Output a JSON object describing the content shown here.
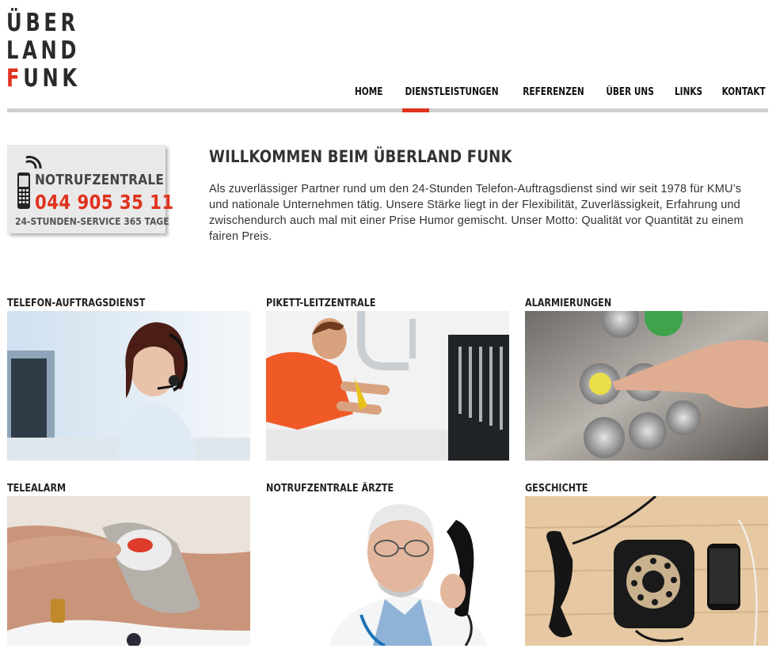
{
  "logo": {
    "line1": "ÜBER",
    "line2": "LAND",
    "line3_first": "F",
    "line3_rest": "UNK"
  },
  "nav": {
    "items": [
      {
        "label": "HOME",
        "active": true
      },
      {
        "label": "DIENSTLEISTUNGEN",
        "active": false
      },
      {
        "label": "REFERENZEN",
        "active": false
      },
      {
        "label": "ÜBER UNS",
        "active": false
      },
      {
        "label": "LINKS",
        "active": false
      },
      {
        "label": "KONTAKT",
        "active": false
      }
    ]
  },
  "badge": {
    "title": "NOTRUFZENTRALE",
    "number": "044 905 35 11",
    "subtitle": "24-STUNDEN-SERVICE 365 TAGE",
    "icon": "mobile-phone-icon"
  },
  "welcome": {
    "title": "WILLKOMMEN BEIM ÜBERLAND FUNK",
    "text": "Als zuverlässiger Partner rund um den 24-Stunden Telefon-Auftragsdienst sind wir seit 1978 für KMU’s und nationale Unternehmen tätig. Unsere Stärke liegt in der Flexibilität, Zuverlässigkeit, Erfahrung und zwischendurch auch mal mit einer Prise Humor gemischt. Unser Motto: Qualität vor Quantität zu einem fairen Preis."
  },
  "tiles": [
    {
      "title": "TELEFON-AUFTRAGSDIENST",
      "image": "headset-operator-photo"
    },
    {
      "title": "PIKETT-LEITZENTRALE",
      "image": "plumber-photo"
    },
    {
      "title": "ALARMIERUNGEN",
      "image": "alarm-button-photo"
    },
    {
      "title": "TELEALARM",
      "image": "wrist-alarm-photo"
    },
    {
      "title": "NOTRUFZENTRALE ÄRZTE",
      "image": "doctor-phone-photo"
    },
    {
      "title": "GESCHICHTE",
      "image": "rotary-phone-photo"
    }
  ],
  "colors": {
    "accent": "#e0321e",
    "nav_bar": "#cfcfcf",
    "badge_bg": "#e9e9e9"
  }
}
